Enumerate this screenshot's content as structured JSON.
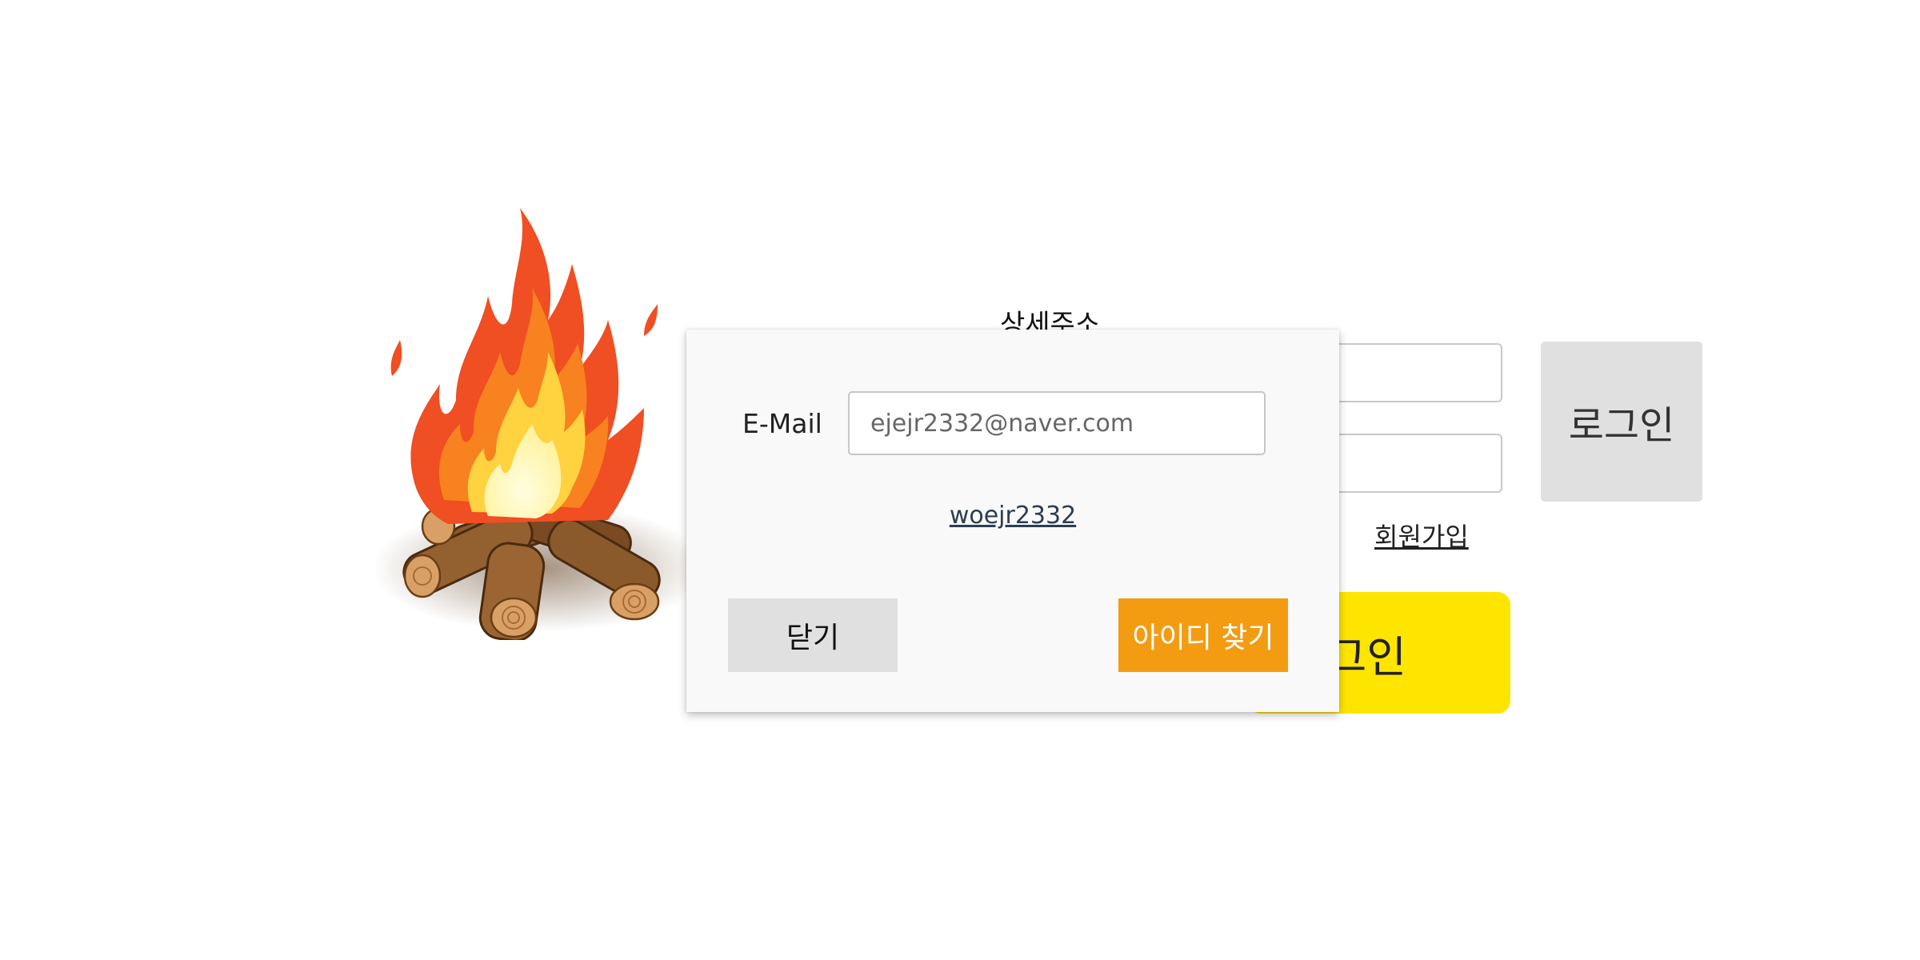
{
  "background": {
    "address_label": "상세주소",
    "login_button_label": "로그인",
    "signup_link_label": "회원가입",
    "kakao_login_label": "그인",
    "kakao_color": "#fee500"
  },
  "modal": {
    "email_label": "E-Mail",
    "email_value": "ejejr2332@naver.com",
    "found_id": "woejr2332",
    "close_button_label": "닫기",
    "find_id_button_label": "아이디 찾기",
    "find_button_color": "#f39c12"
  },
  "illustration": {
    "name": "campfire-icon"
  }
}
